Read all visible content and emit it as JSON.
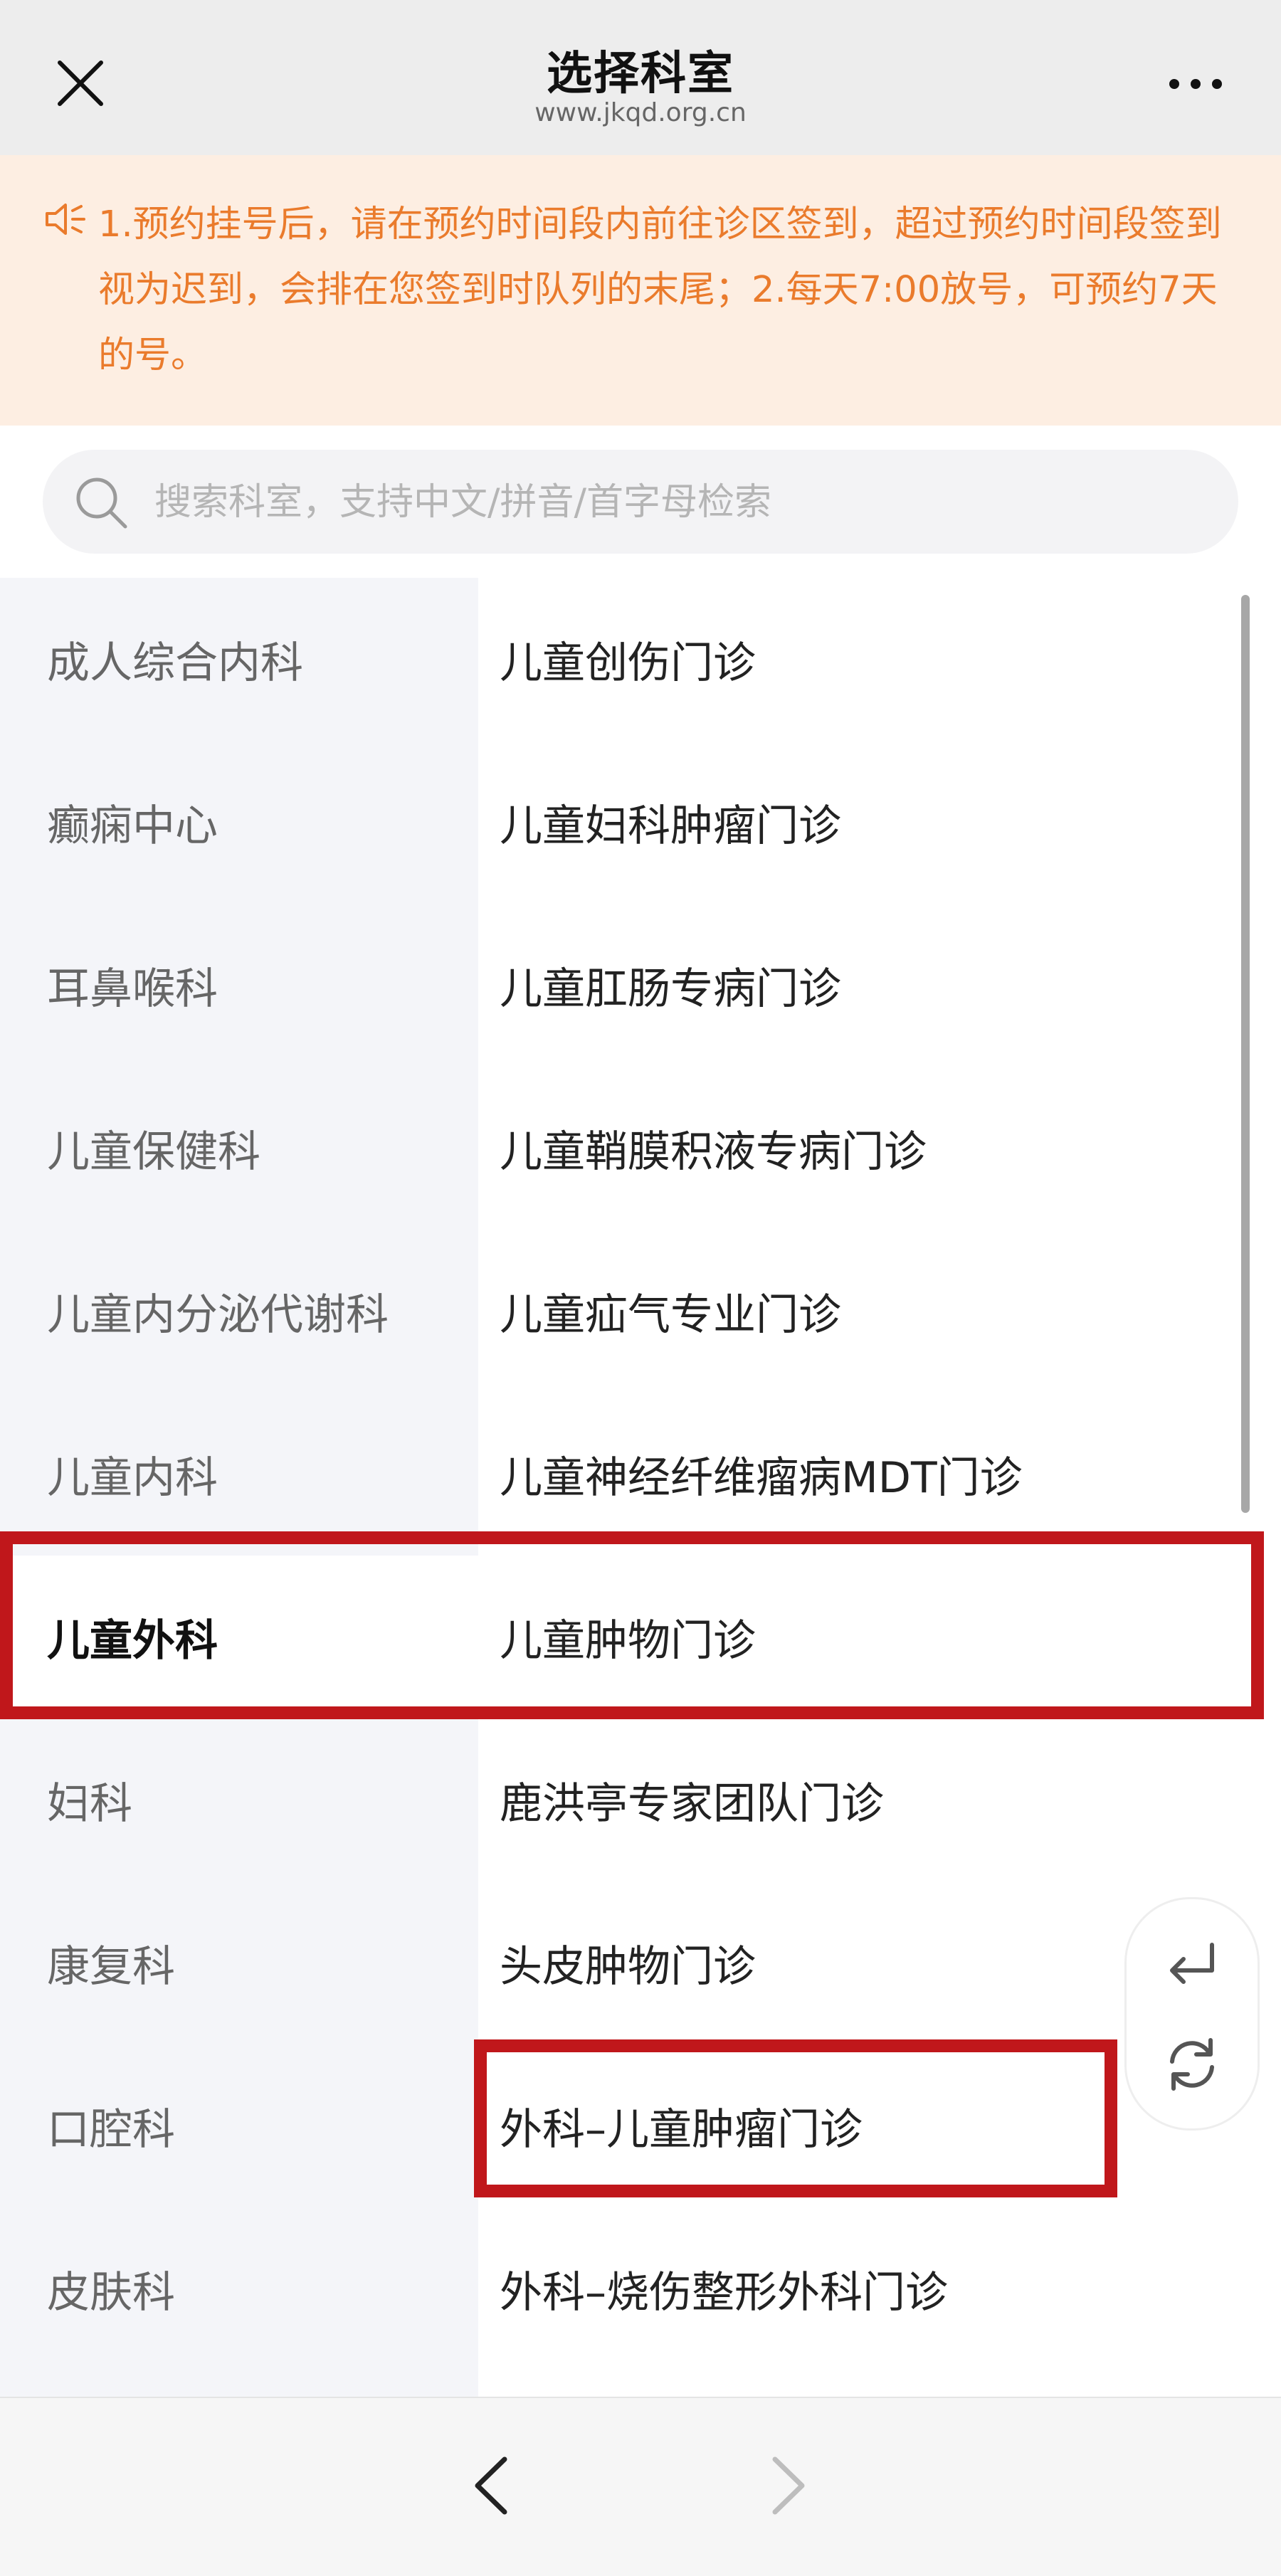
{
  "header": {
    "title": "选择科室",
    "url": "www.jkqd.org.cn",
    "close_icon": "close-icon",
    "more_icon": "more-icon"
  },
  "notice": {
    "icon": "speaker-icon",
    "text": "1.预约挂号后，请在预约时间段内前往诊区签到，超过预约时间段签到视为迟到，会排在您签到时队列的末尾；2.每天7:00放号，可预约7天的号。"
  },
  "search": {
    "placeholder": "搜索科室，支持中文/拼音/首字母检索",
    "value": ""
  },
  "departments": {
    "items": [
      {
        "label": "成人综合内科"
      },
      {
        "label": "癫痫中心"
      },
      {
        "label": "耳鼻喉科"
      },
      {
        "label": "儿童保健科"
      },
      {
        "label": "儿童内分泌代谢科"
      },
      {
        "label": "儿童内科"
      },
      {
        "label": "儿童外科"
      },
      {
        "label": "妇科"
      },
      {
        "label": "康复科"
      },
      {
        "label": "口腔科"
      },
      {
        "label": "皮肤科"
      }
    ],
    "selected": "儿童外科"
  },
  "clinics": {
    "items": [
      {
        "label": "儿童创伤门诊"
      },
      {
        "label": "儿童妇科肿瘤门诊"
      },
      {
        "label": "儿童肛肠专病门诊"
      },
      {
        "label": "儿童鞘膜积液专病门诊"
      },
      {
        "label": "儿童疝气专业门诊"
      },
      {
        "label": "儿童神经纤维瘤病MDT门诊"
      },
      {
        "label": "儿童肿物门诊"
      },
      {
        "label": "鹿洪亭专家团队门诊"
      },
      {
        "label": "头皮肿物门诊"
      },
      {
        "label": "外科–儿童肿瘤门诊"
      },
      {
        "label": "外科–烧伤整形外科门诊"
      }
    ]
  },
  "floating_buttons": [
    "return-icon",
    "refresh-icon"
  ],
  "bottom_nav": [
    "back-icon",
    "forward-icon"
  ],
  "colors": {
    "notice_bg": "#fdeee2",
    "notice_text": "#ea7b2c",
    "highlight": "#c0171b",
    "left_panel_bg": "#f4f5f9"
  }
}
